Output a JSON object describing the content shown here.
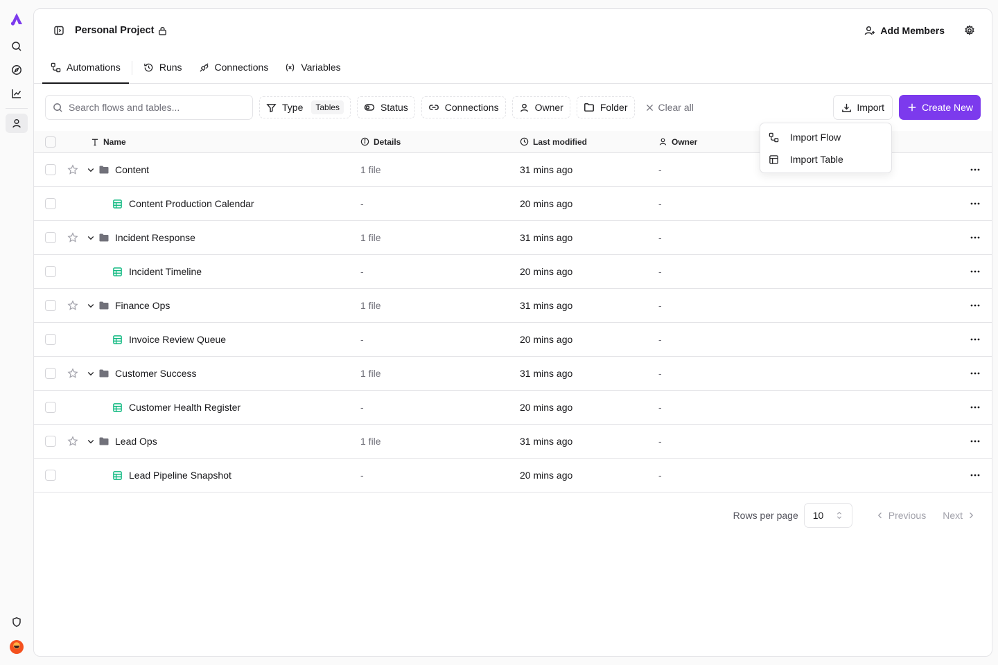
{
  "project": {
    "title": "Personal Project"
  },
  "header": {
    "add_members_label": "Add Members"
  },
  "tabs": [
    {
      "label": "Automations",
      "active": true
    },
    {
      "label": "Runs"
    },
    {
      "label": "Connections"
    },
    {
      "label": "Variables"
    }
  ],
  "toolbar": {
    "search_placeholder": "Search flows and tables...",
    "filters": {
      "type": "Type",
      "type_chip": "Tables",
      "status": "Status",
      "connections": "Connections",
      "owner": "Owner",
      "folder": "Folder"
    },
    "clear_all": "Clear all",
    "import_label": "Import",
    "create_label": "Create New"
  },
  "import_menu": {
    "items": [
      {
        "label": "Import Flow",
        "icon": "flow-icon"
      },
      {
        "label": "Import Table",
        "icon": "table-icon"
      }
    ]
  },
  "table": {
    "columns": {
      "name": "Name",
      "details": "Details",
      "last_modified": "Last modified",
      "owner": "Owner"
    },
    "rows": [
      {
        "kind": "folder",
        "name": "Content",
        "details": "1 file",
        "modified": "31 mins ago",
        "owner": "-"
      },
      {
        "kind": "table",
        "name": "Content Production Calendar",
        "details": "-",
        "modified": "20 mins ago",
        "owner": "-"
      },
      {
        "kind": "folder",
        "name": "Incident Response",
        "details": "1 file",
        "modified": "31 mins ago",
        "owner": "-"
      },
      {
        "kind": "table",
        "name": "Incident Timeline",
        "details": "-",
        "modified": "20 mins ago",
        "owner": "-"
      },
      {
        "kind": "folder",
        "name": "Finance Ops",
        "details": "1 file",
        "modified": "31 mins ago",
        "owner": "-"
      },
      {
        "kind": "table",
        "name": "Invoice Review Queue",
        "details": "-",
        "modified": "20 mins ago",
        "owner": "-"
      },
      {
        "kind": "folder",
        "name": "Customer Success",
        "details": "1 file",
        "modified": "31 mins ago",
        "owner": "-"
      },
      {
        "kind": "table",
        "name": "Customer Health Register",
        "details": "-",
        "modified": "20 mins ago",
        "owner": "-"
      },
      {
        "kind": "folder",
        "name": "Lead Ops",
        "details": "1 file",
        "modified": "31 mins ago",
        "owner": "-"
      },
      {
        "kind": "table",
        "name": "Lead Pipeline Snapshot",
        "details": "-",
        "modified": "20 mins ago",
        "owner": "-"
      }
    ]
  },
  "pagination": {
    "rows_per_page_label": "Rows per page",
    "rows_per_page_value": "10",
    "previous_label": "Previous",
    "next_label": "Next"
  },
  "colors": {
    "accent": "#7c3aed",
    "table_icon": "#10b981",
    "folder_icon": "#71717a"
  }
}
